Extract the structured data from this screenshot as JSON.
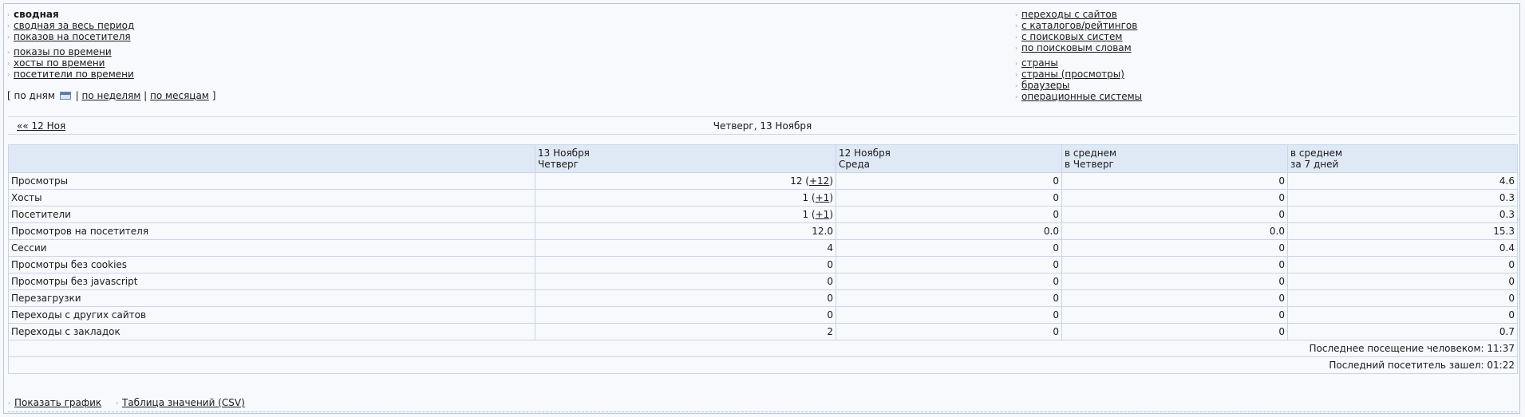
{
  "menu_left": {
    "group1": [
      "сводная",
      "сводная за весь период",
      "показов на посетителя"
    ],
    "group2": [
      "показы по времени",
      "хосты по времени",
      "посетители по времени"
    ]
  },
  "menu_right": {
    "group1": [
      "переходы с сайтов",
      "с каталогов/рейтингов",
      "с поисковых систем",
      "по поисковым словам"
    ],
    "group2": [
      "страны",
      "страны (просмотры)",
      "браузеры",
      "операционные системы"
    ]
  },
  "period": {
    "open": "[",
    "by_days": "по дням",
    "sep": "|",
    "by_weeks": "по неделям",
    "by_months": "по месяцам",
    "close": "]",
    "icon": "calendar-icon"
  },
  "nav": {
    "prev": "«« 12 Ноя",
    "title": "Четверг, 13 Ноября"
  },
  "table": {
    "headers": [
      {
        "l1": "",
        "l2": ""
      },
      {
        "l1": "13 Ноября",
        "l2": "Четверг"
      },
      {
        "l1": "12 Ноября",
        "l2": "Среда"
      },
      {
        "l1": "в среднем",
        "l2": "в Четверг"
      },
      {
        "l1": "в среднем",
        "l2": "за 7 дней"
      }
    ],
    "rows": [
      {
        "label": "Просмотры",
        "c1": "12",
        "c1_delta": "+12",
        "c2": "0",
        "c3": "0",
        "c4": "4.6"
      },
      {
        "label": "Хосты",
        "c1": "1",
        "c1_delta": "+1",
        "c2": "0",
        "c3": "0",
        "c4": "0.3"
      },
      {
        "label": "Посетители",
        "c1": "1",
        "c1_delta": "+1",
        "c2": "0",
        "c3": "0",
        "c4": "0.3"
      },
      {
        "label": "Просмотров на посетителя",
        "c1": "12.0",
        "c1_delta": "",
        "c2": "0.0",
        "c3": "0.0",
        "c4": "15.3"
      },
      {
        "label": "Сессии",
        "c1": "4",
        "c1_delta": "",
        "c2": "0",
        "c3": "0",
        "c4": "0.4"
      },
      {
        "label": "Просмотры без cookies",
        "c1": "0",
        "c1_delta": "",
        "c2": "0",
        "c3": "0",
        "c4": "0"
      },
      {
        "label": "Просмотры без javascript",
        "c1": "0",
        "c1_delta": "",
        "c2": "0",
        "c3": "0",
        "c4": "0"
      },
      {
        "label": "Перезагрузки",
        "c1": "0",
        "c1_delta": "",
        "c2": "0",
        "c3": "0",
        "c4": "0"
      },
      {
        "label": "Переходы с других сайтов",
        "c1": "0",
        "c1_delta": "",
        "c2": "0",
        "c3": "0",
        "c4": "0"
      },
      {
        "label": "Переходы с закладок",
        "c1": "2",
        "c1_delta": "",
        "c2": "0",
        "c3": "0",
        "c4": "0.7"
      }
    ],
    "footer": [
      "Последнее посещение человеком: 11:37",
      "Последний посетитель зашел: 01:22"
    ]
  },
  "bottom_links": [
    "Показать график",
    "Таблица значений (CSV)"
  ]
}
